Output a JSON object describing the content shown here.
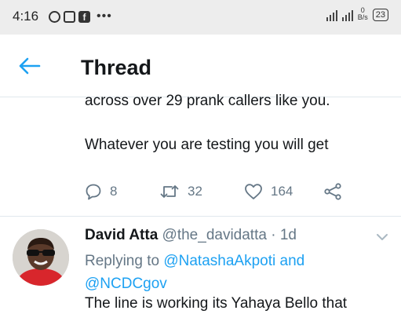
{
  "status_bar": {
    "time": "4:16",
    "dots": "•••",
    "net_speed_value": "0",
    "net_speed_unit": "B/s",
    "battery": "23",
    "notification_icons": [
      "chat-icon",
      "image-icon",
      "facebook-icon"
    ]
  },
  "header": {
    "title": "Thread",
    "back_icon": "arrow-left-icon"
  },
  "tweet1": {
    "text_line1": "across over 29 prank callers like you.",
    "text_line2": "Whatever you are testing you will get",
    "replies": "8",
    "retweets": "32",
    "likes": "164"
  },
  "tweet2": {
    "name": "David Atta",
    "handle": "@the_davidatta",
    "time": "1d",
    "replying_prefix": "Replying to",
    "mention1": "@NatashaAkpoti",
    "and_word": "and",
    "mention2": "@NCDCgov",
    "text": "The line is working its Yahaya Bello that"
  },
  "colors": {
    "accent": "#1da1f2",
    "secondary_text": "#657786",
    "primary_text": "#14171a",
    "status_bar_bg": "#ededed"
  }
}
